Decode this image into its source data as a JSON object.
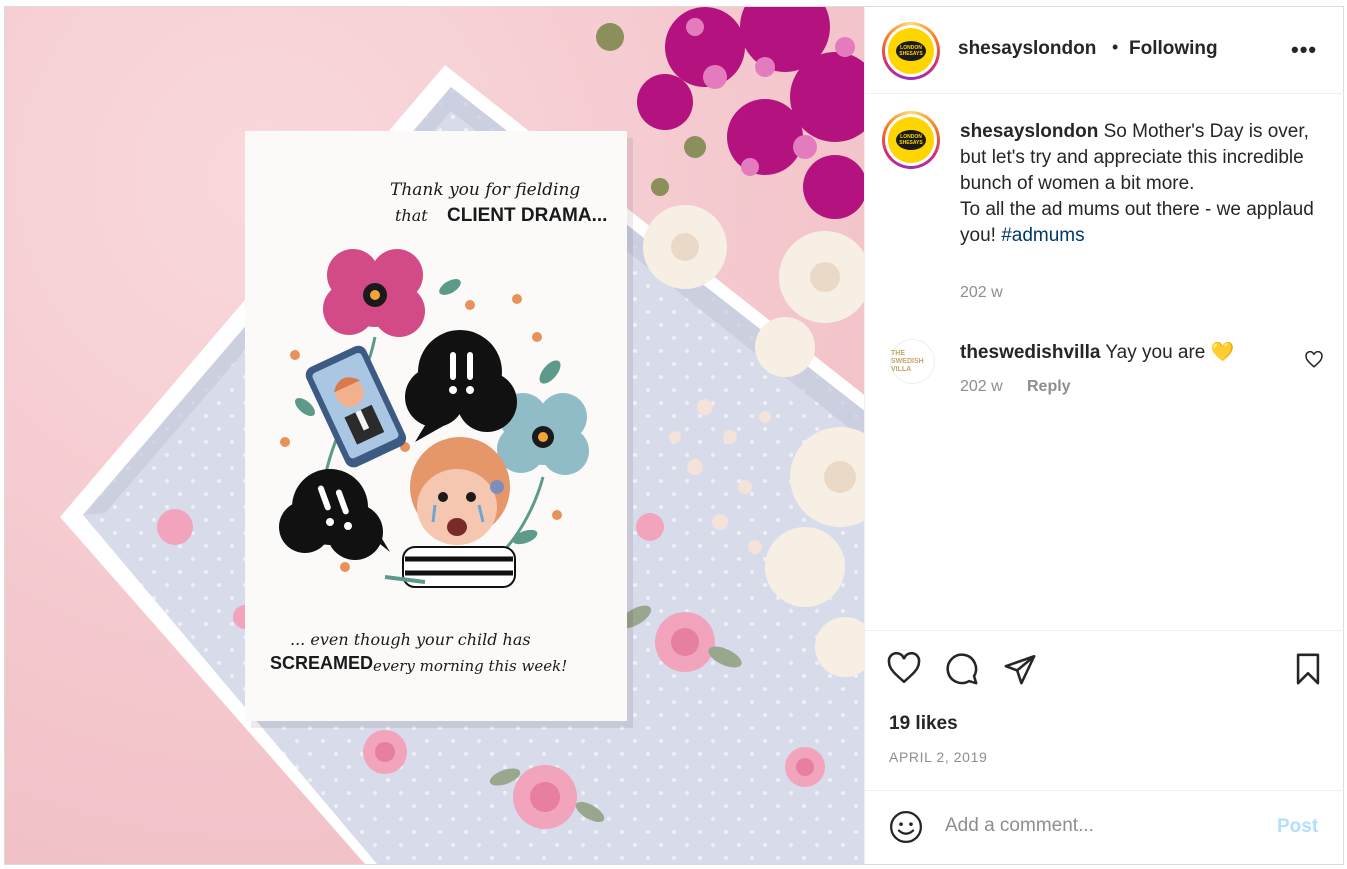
{
  "post": {
    "image_alt": "Mother's Day card illustration on a floral tray with flowers",
    "card_text_top_1": "Thank you for fielding",
    "card_text_top_2a": "that",
    "card_text_top_2b": "CLIENT DRAMA...",
    "card_text_bottom_1": "... even though your child has",
    "card_text_bottom_2a": "SCREAMED",
    "card_text_bottom_2b": "every morning this week!"
  },
  "header": {
    "username": "shesayslondon",
    "separator": "•",
    "follow_status": "Following",
    "more_icon": "more-horizontal-icon",
    "avatar_logo_top": "LONDON",
    "avatar_logo_bottom": "SHESAYS"
  },
  "caption": {
    "username": "shesayslondon",
    "text_1": "So Mother's Day is over, but let's try and appreciate this incredible bunch of women a bit more.",
    "text_2": "To all the ad mums out there - we applaud you!",
    "hashtag": "#admums",
    "time": "202 w"
  },
  "comments": [
    {
      "username": "theswedishvilla",
      "avatar_text": "THE SWEDISH VILLA",
      "text": "Yay you are 💛",
      "time": "202 w",
      "reply_label": "Reply"
    }
  ],
  "actions": {
    "like_icon": "heart-icon",
    "comment_icon": "comment-icon",
    "share_icon": "send-icon",
    "save_icon": "bookmark-icon",
    "likes": "19 likes",
    "date": "APRIL 2, 2019"
  },
  "add_comment": {
    "emoji_icon": "emoji-icon",
    "placeholder": "Add a comment...",
    "post_label": "Post"
  },
  "colors": {
    "link": "#00376b",
    "muted": "#8e8e8e",
    "post_disabled": "#b2dffc",
    "logo_yellow": "#ffd500"
  }
}
